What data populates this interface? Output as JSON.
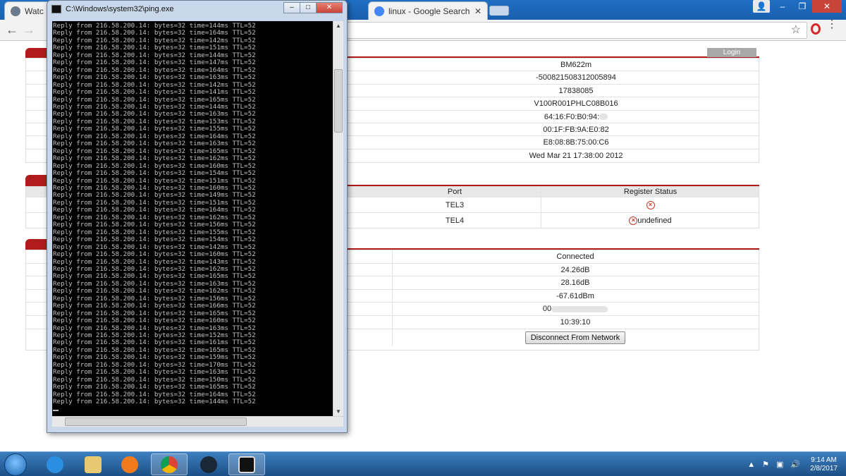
{
  "browser": {
    "tabs": [
      {
        "label": "Watc",
        "favicon_color": "#6b7b8c"
      },
      {
        "label": "linux - Google Search",
        "favicon_color": "#4285f4"
      }
    ],
    "close_symbol": "✕",
    "window_controls": {
      "minimize": "–",
      "restore": "❐",
      "close": "✕"
    },
    "nav": {
      "back": "←",
      "forward": "→",
      "star": "☆",
      "menu": "⋮"
    }
  },
  "cmd": {
    "title": "C:\\Windows\\system32\\ping.exe",
    "controls": {
      "minimize": "–",
      "maximize": "□",
      "close": "✕"
    },
    "reply_host": "216.58.200.14",
    "reply_bytes": 32,
    "reply_ttl": 52,
    "reply_times_ms": [
      144,
      164,
      142,
      151,
      144,
      147,
      164,
      163,
      142,
      141,
      165,
      144,
      163,
      153,
      155,
      164,
      163,
      165,
      162,
      160,
      154,
      151,
      160,
      149,
      151,
      164,
      162,
      156,
      155,
      154,
      142,
      160,
      143,
      162,
      165,
      163,
      162,
      156,
      166,
      165,
      160,
      163,
      152,
      161,
      165,
      159,
      170,
      163,
      150,
      165,
      164,
      144
    ]
  },
  "router": {
    "login_label": "Login",
    "device_info": [
      "BM622m",
      "-500821508312005894",
      "17838085",
      "V100R001PHLC08B016",
      "64:16:F0:B0:94:",
      "00:1F:FB:9A:E0:82",
      "E8:08:8B:75:00:C6",
      "Wed Mar 21 17:38:00 2012"
    ],
    "ports": {
      "header_port": "Port",
      "header_status": "Register Status",
      "rows": [
        {
          "port": "TEL3",
          "status": ""
        },
        {
          "port": "TEL4",
          "status": "undefined"
        }
      ]
    },
    "network": {
      "rows": [
        "Connected",
        "24.26dB",
        "28.16dB",
        "-67.61dBm",
        "00",
        "10:39:10"
      ],
      "disconnect_label": "Disconnect From Network"
    },
    "accent_color": "#b01c1c"
  },
  "taskbar": {
    "apps": [
      "internet-explorer",
      "file-explorer",
      "media-player",
      "chrome",
      "steam",
      "cmd"
    ],
    "clock_time": "9:14 AM",
    "clock_date": "2/8/2017",
    "tray_up_arrow": "▲",
    "volume_symbol": "🔊"
  }
}
